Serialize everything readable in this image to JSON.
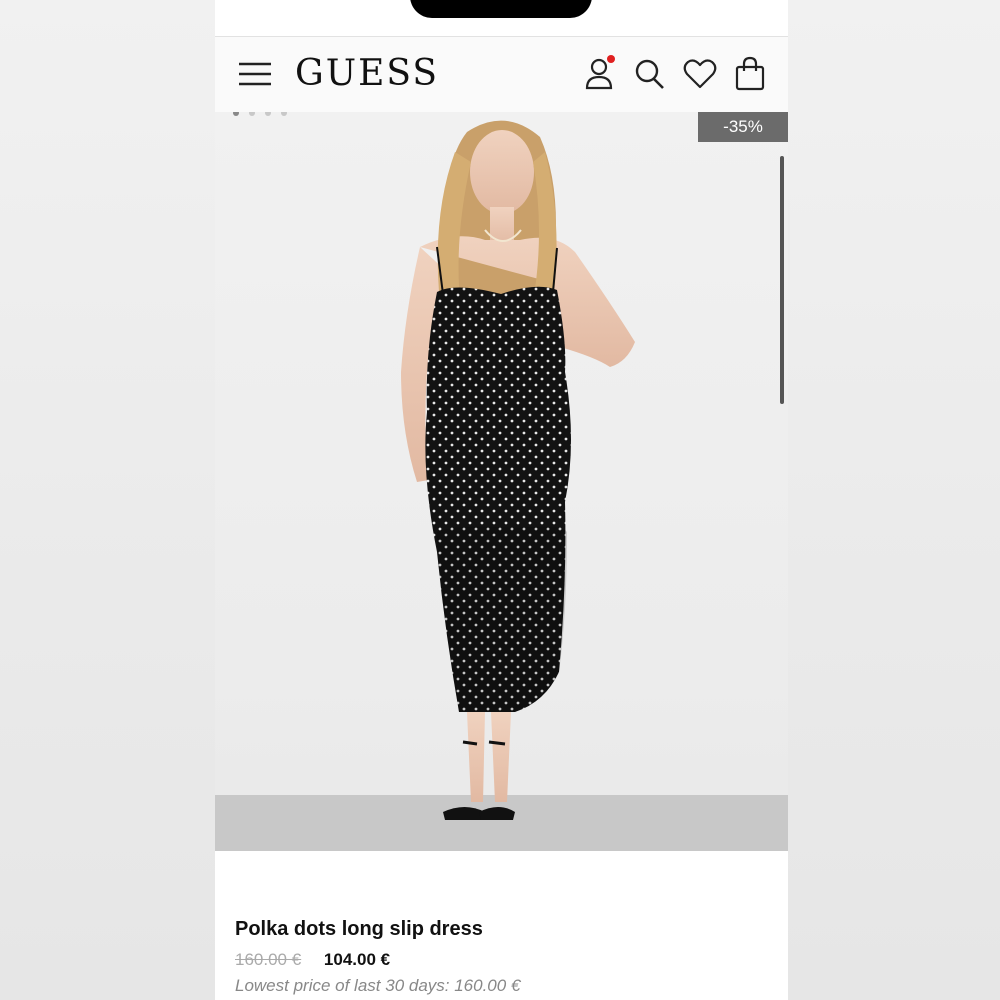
{
  "brand": {
    "logo_text": "GUESS"
  },
  "header": {
    "icons": [
      "menu-icon",
      "account-icon",
      "search-icon",
      "heart-icon",
      "shopping-bag-icon"
    ],
    "account_notification_color": "#e02020"
  },
  "gallery": {
    "discount_badge": "-35%",
    "slide_count": 4,
    "active_slide": 1
  },
  "product": {
    "title": "Polka dots long slip dress",
    "old_price": "160.00 €",
    "new_price": "104.00 €",
    "lowest_price_note": "Lowest price of last 30 days: 160.00 €"
  },
  "colors": {
    "badge_bg": "#6b6b6b",
    "text_primary": "#111111",
    "text_muted": "#888888"
  }
}
